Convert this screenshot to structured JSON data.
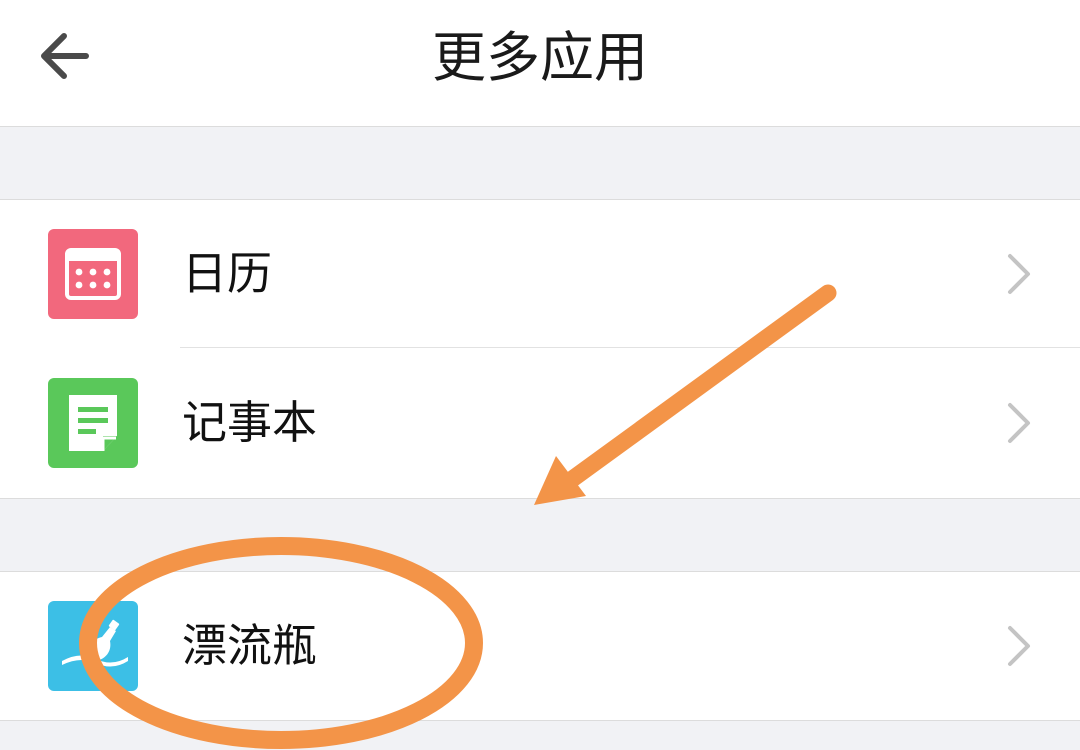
{
  "header": {
    "title": "更多应用",
    "back_icon": "back-arrow-icon"
  },
  "groups": [
    {
      "items": [
        {
          "label": "日历",
          "icon": "calendar-icon",
          "icon_color": "#f2687d"
        },
        {
          "label": "记事本",
          "icon": "notepad-icon",
          "icon_color": "#5ac85a"
        }
      ]
    },
    {
      "items": [
        {
          "label": "漂流瓶",
          "icon": "drift-bottle-icon",
          "icon_color": "#3cbfe6"
        }
      ]
    }
  ],
  "annotation": {
    "color": "#f39448",
    "marks": [
      "pointer-arrow",
      "highlight-ellipse"
    ]
  }
}
